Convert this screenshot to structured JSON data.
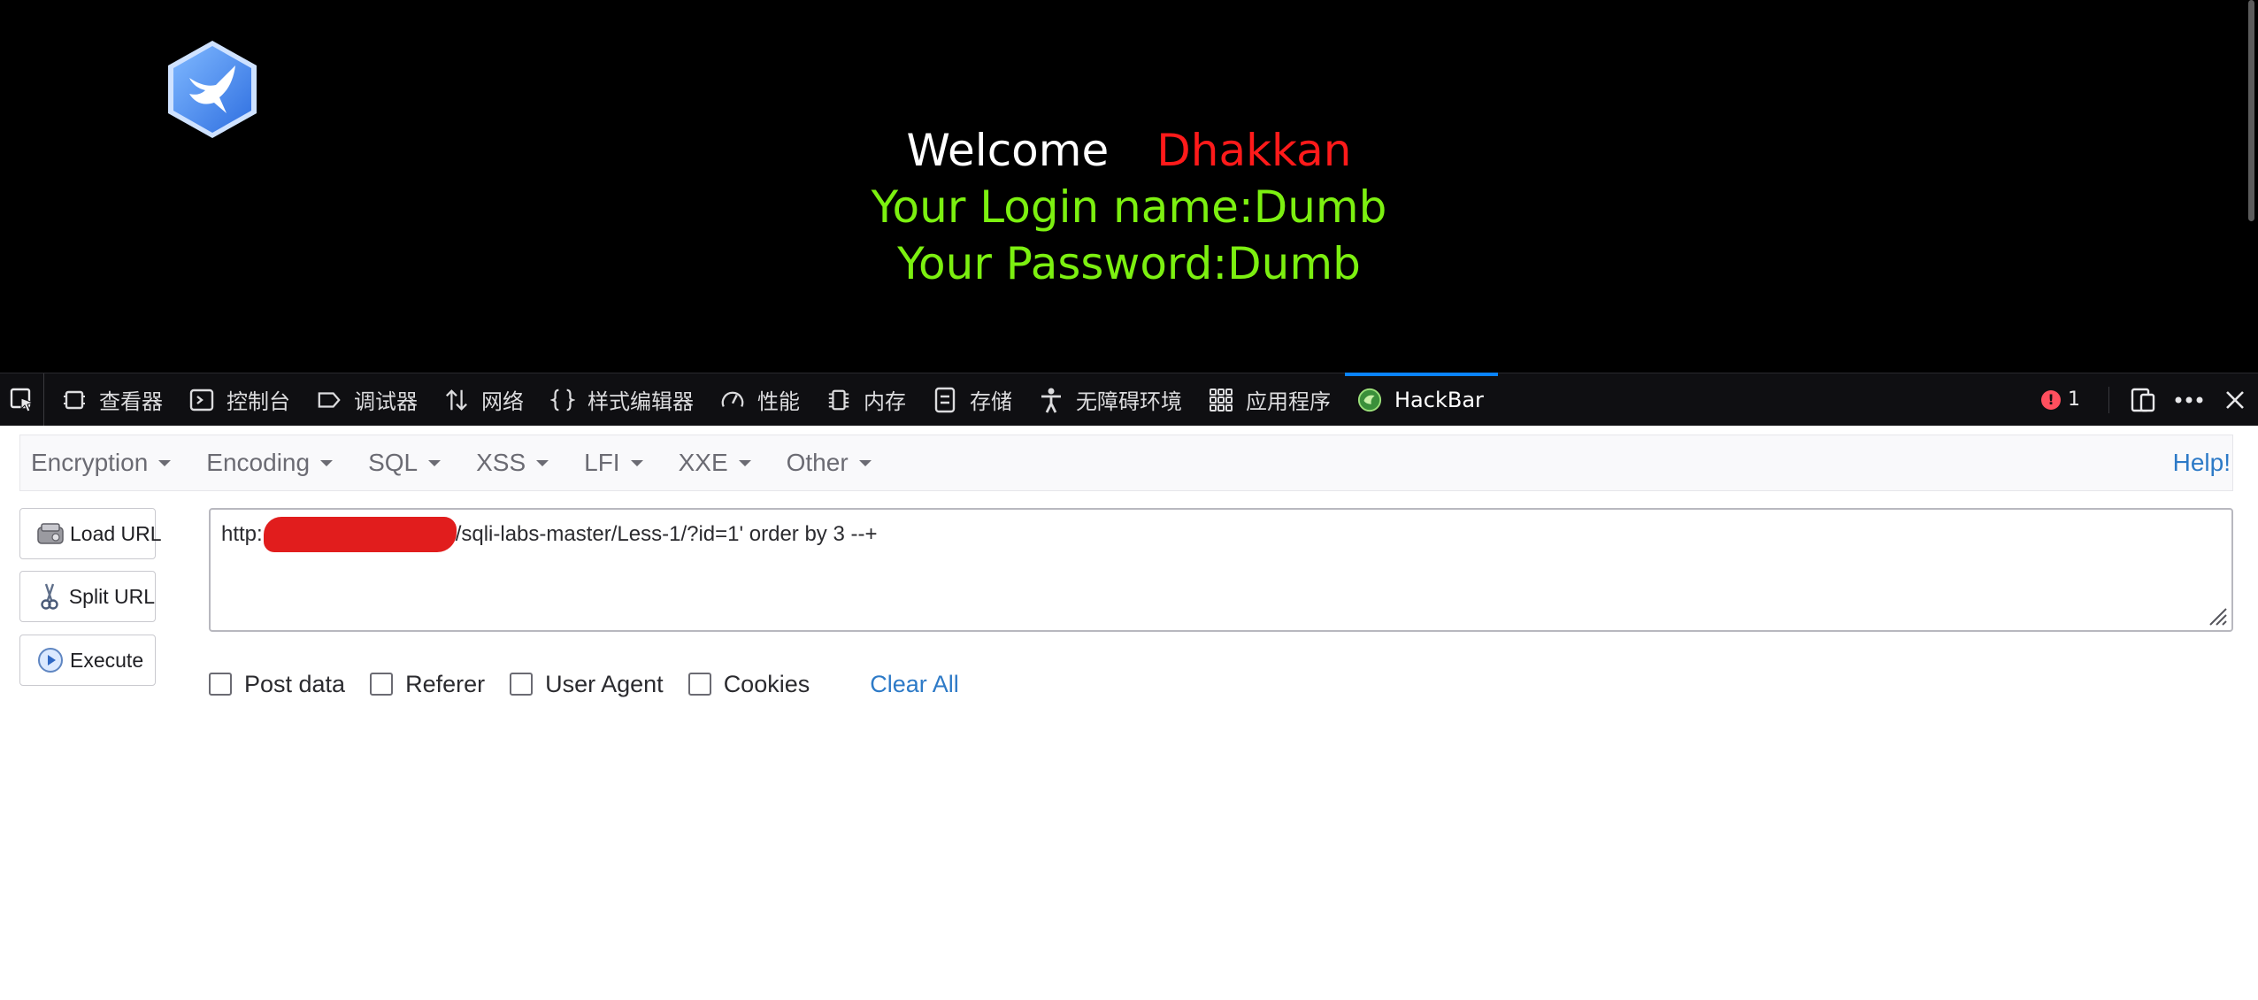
{
  "page": {
    "welcome": "Welcome",
    "user_name": "Dhakkan",
    "login_line": "Your Login name:Dumb",
    "password_line": "Your Password:Dumb"
  },
  "devtools": {
    "tabs": [
      {
        "label": "查看器",
        "icon": "inspector-icon"
      },
      {
        "label": "控制台",
        "icon": "console-icon"
      },
      {
        "label": "调试器",
        "icon": "debugger-icon"
      },
      {
        "label": "网络",
        "icon": "network-icon"
      },
      {
        "label": "样式编辑器",
        "icon": "style-editor-icon"
      },
      {
        "label": "性能",
        "icon": "performance-icon"
      },
      {
        "label": "内存",
        "icon": "memory-icon"
      },
      {
        "label": "存储",
        "icon": "storage-icon"
      },
      {
        "label": "无障碍环境",
        "icon": "accessibility-icon"
      },
      {
        "label": "应用程序",
        "icon": "application-icon"
      },
      {
        "label": "HackBar",
        "icon": "hackbar-icon",
        "active": true
      }
    ],
    "error_count": "1"
  },
  "hackbar": {
    "menu": [
      "Encryption",
      "Encoding",
      "SQL",
      "XSS",
      "LFI",
      "XXE",
      "Other"
    ],
    "help": "Help!",
    "buttons": {
      "load_url": "Load URL",
      "split_url": "Split URL",
      "execute": "Execute"
    },
    "url_prefix": "http:",
    "url_suffix": "/sqli-labs-master/Less-1/?id=1' order by 3 --+",
    "options": [
      "Post data",
      "Referer",
      "User Agent",
      "Cookies"
    ],
    "clear_all": "Clear All"
  },
  "colors": {
    "page_bg": "#000000",
    "welcome_text": "#ffffff",
    "user_name": "#ff1a1a",
    "login_text": "#7cf010",
    "devtools_bg": "#0f0f12",
    "active_tab_accent": "#0a84ff",
    "link": "#2d7ac7",
    "redaction": "#e11d1d"
  }
}
